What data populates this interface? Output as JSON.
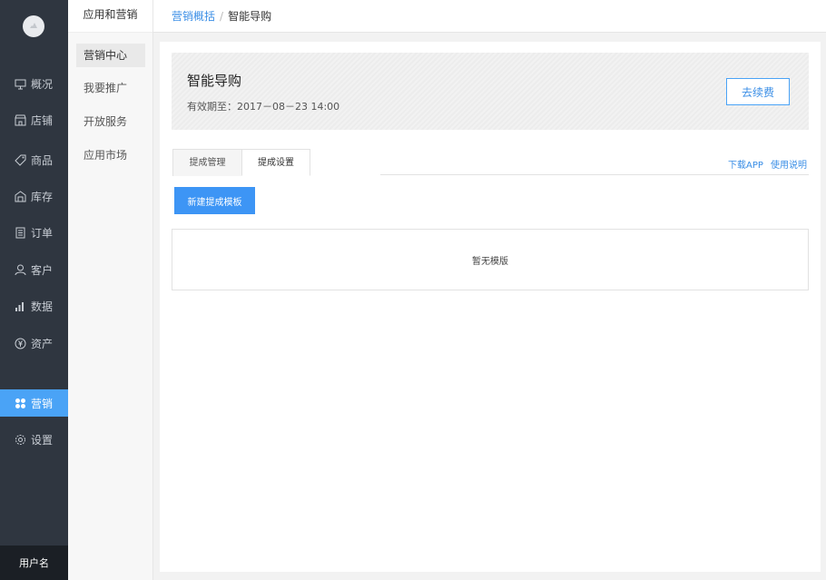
{
  "nav": {
    "items": [
      {
        "label": "概况",
        "icon": "monitor-icon"
      },
      {
        "label": "店铺",
        "icon": "store-icon"
      },
      {
        "label": "商品",
        "icon": "tag-icon"
      },
      {
        "label": "库存",
        "icon": "warehouse-icon"
      },
      {
        "label": "订单",
        "icon": "order-icon"
      },
      {
        "label": "客户",
        "icon": "user-icon"
      },
      {
        "label": "数据",
        "icon": "bar-chart-icon"
      },
      {
        "label": "资产",
        "icon": "yuan-icon"
      },
      {
        "label": "营销",
        "icon": "apps-icon"
      },
      {
        "label": "设置",
        "icon": "gear-icon"
      }
    ],
    "active_label": "营销",
    "username": "用户名"
  },
  "subnav": {
    "title": "应用和营销",
    "items": [
      "营销中心",
      "我要推广",
      "开放服务",
      "应用市场"
    ],
    "active": "营销中心"
  },
  "breadcrumb": {
    "parent": "营销概括",
    "separator": "/",
    "current": "智能导购"
  },
  "header": {
    "title": "智能导购",
    "expire": "有效期至：2017－08－23 14:00",
    "renew_label": "去续费"
  },
  "tabs": [
    "提成管理",
    "提成设置"
  ],
  "active_tab": "提成设置",
  "links": {
    "download": "下载APP",
    "manual": "使用说明"
  },
  "new_template_label": "新建提成模板",
  "empty_text": "暂无模版",
  "colors": {
    "nav_bg": "#2f3640",
    "accent": "#4aa3f6",
    "primary_button": "#3d95f5"
  }
}
